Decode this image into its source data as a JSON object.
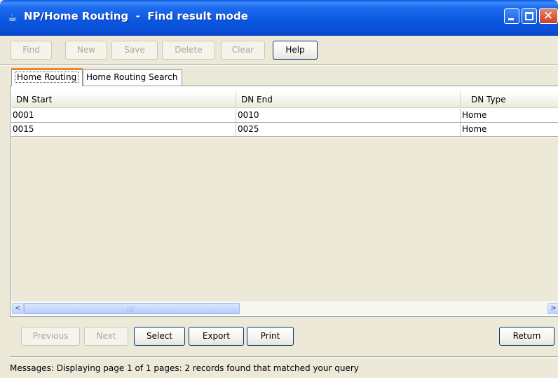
{
  "window": {
    "title": "NP/Home Routing  -  Find result mode",
    "app_icon": "java-cup-icon",
    "controls": [
      "minimize-icon",
      "maximize-icon",
      "close-icon"
    ]
  },
  "toolbar": {
    "find": "Find",
    "new": "New",
    "save": "Save",
    "delete": "Delete",
    "clear": "Clear",
    "help": "Help"
  },
  "tabs": [
    {
      "label": "Home Routing",
      "active": true
    },
    {
      "label": "Home Routing Search",
      "active": false
    }
  ],
  "table": {
    "columns": [
      "DN Start",
      "DN End",
      "DN Type"
    ],
    "rows": [
      [
        "0001",
        "0010",
        "Home"
      ],
      [
        "0015",
        "0025",
        "Home"
      ]
    ]
  },
  "scrollbar": {
    "left_arrow": "<",
    "right_arrow": ">",
    "grip": "|||"
  },
  "navigation": {
    "previous": "Previous",
    "next": "Next",
    "select": "Select",
    "export": "Export",
    "print": "Print",
    "return": "Return"
  },
  "status": {
    "message": "Messages:  Displaying page 1 of 1 pages:  2 records found that matched your query"
  },
  "colors": {
    "titlebar": "#0a56e0",
    "window_bg": "#ece9d8",
    "active_tab_accent": "#e68b2c",
    "button_border": "#003c74"
  }
}
